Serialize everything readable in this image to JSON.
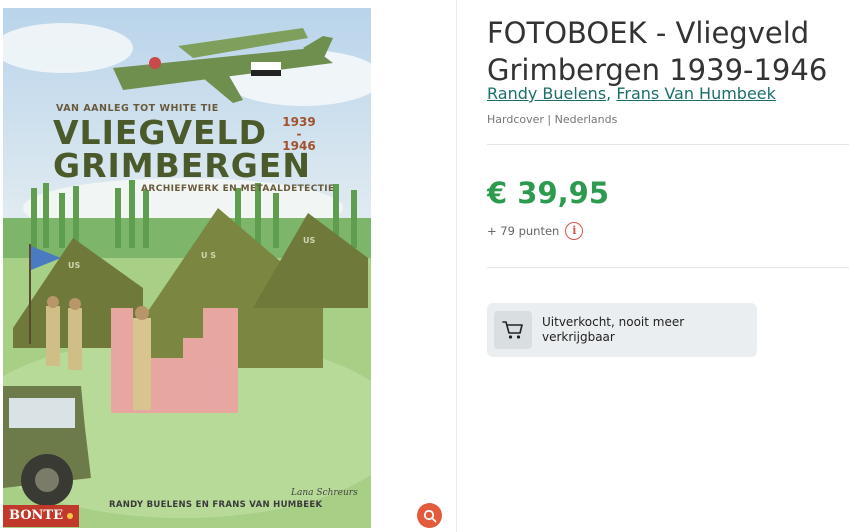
{
  "product": {
    "title_line1": "FOTOBOEK - Vliegveld",
    "title_line2": "Grimbergen 1939-1946",
    "author1": "Randy Buelens",
    "author_separator": ", ",
    "author2": "Frans Van Humbeek",
    "meta": "Hardcover | Nederlands",
    "price": "€ 39,95",
    "points": "+ 79 punten",
    "info_icon": "info-icon",
    "soldout_line1": "Uitverkocht, nooit meer",
    "soldout_line2": "verkrijgbaar",
    "cart_icon": "cart-icon",
    "zoom_icon": "zoom-icon"
  },
  "cover": {
    "subtitle_top": "VAN AANLEG TOT WHITE TIE",
    "title_line1": "VLIEGVELD",
    "title_line2": "GRIMBERGEN",
    "year_start": "1939",
    "year_dash": "-",
    "year_end": "1946",
    "subtitle_bottom": "ARCHIEFWERK EN METAALDETECTIE",
    "authors": "RANDY BUELENS EN FRANS VAN HUMBEEK",
    "publisher": "BONTE",
    "tent_label": "US",
    "tent_label_center": "U S",
    "signature": "Lana Schreurs"
  },
  "colors": {
    "price_green": "#2e9a4f",
    "link_teal": "#1a6f6a",
    "info_red": "#d9534f",
    "zoom_red": "#e35a3d",
    "publisher_red": "#c0392b"
  }
}
